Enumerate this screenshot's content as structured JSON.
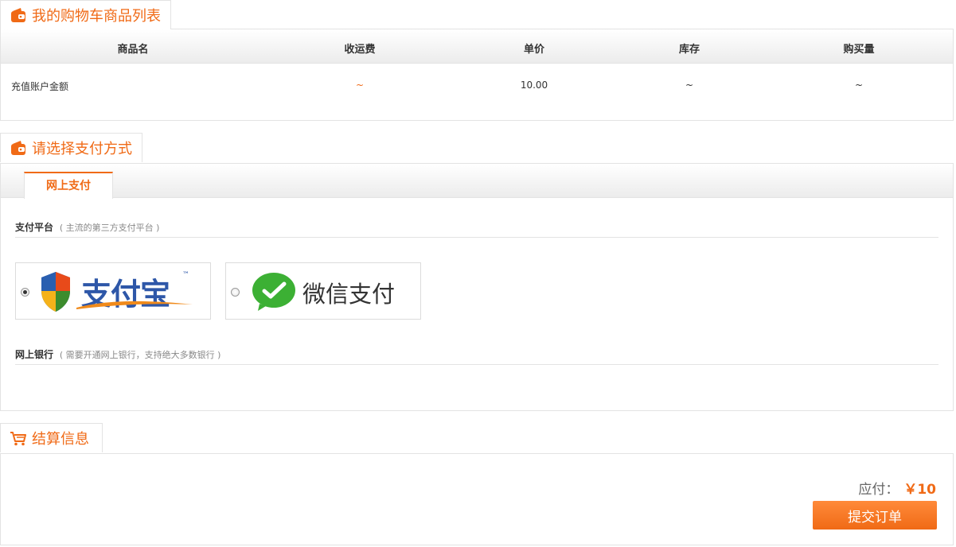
{
  "cart": {
    "title": "我的购物车商品列表",
    "columns": [
      "商品名",
      "收运费",
      "单价",
      "库存",
      "购买量"
    ],
    "rows": [
      {
        "name": "充值账户金额",
        "shipping": "~",
        "price": "10.00",
        "stock": "~",
        "qty": "~"
      }
    ]
  },
  "payment": {
    "title": "请选择支付方式",
    "tab_label": "网上支付",
    "platform_title": "支付平台",
    "platform_hint": "( 主流的第三方支付平台 )",
    "options": [
      {
        "logo_text": "支付宝",
        "tm": "™",
        "selected": true
      },
      {
        "logo_text": "微信支付",
        "selected": false
      }
    ],
    "bank_title": "网上银行",
    "bank_hint": "( 需要开通网上银行，支持绝大多数银行 )"
  },
  "settlement": {
    "title": "结算信息",
    "due_label": "应付：",
    "due_amount": "￥10",
    "submit_label": "提交订单"
  },
  "colors": {
    "accent": "#f06a16",
    "border": "#e3e3e3"
  },
  "icons": {
    "section": "wallet-icon",
    "settlement": "cart-icon"
  }
}
